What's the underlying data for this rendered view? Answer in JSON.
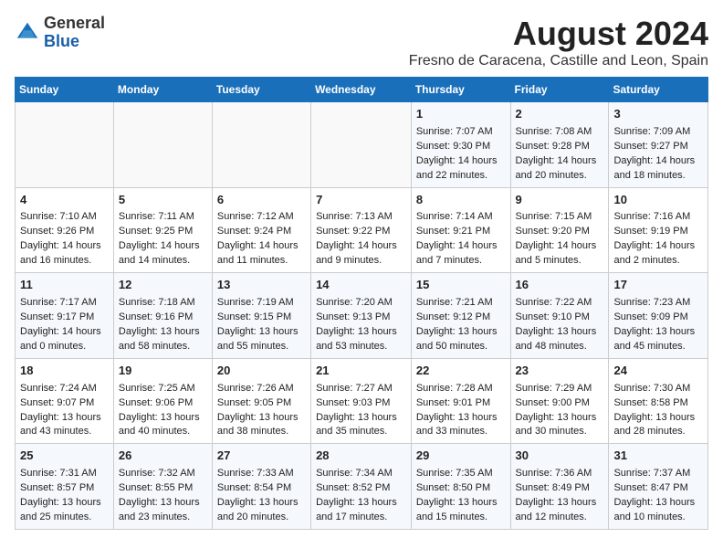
{
  "header": {
    "logo_general": "General",
    "logo_blue": "Blue",
    "month_year": "August 2024",
    "location": "Fresno de Caracena, Castille and Leon, Spain"
  },
  "weekdays": [
    "Sunday",
    "Monday",
    "Tuesday",
    "Wednesday",
    "Thursday",
    "Friday",
    "Saturday"
  ],
  "weeks": [
    [
      {
        "day": "",
        "sunrise": "",
        "sunset": "",
        "daylight": ""
      },
      {
        "day": "",
        "sunrise": "",
        "sunset": "",
        "daylight": ""
      },
      {
        "day": "",
        "sunrise": "",
        "sunset": "",
        "daylight": ""
      },
      {
        "day": "",
        "sunrise": "",
        "sunset": "",
        "daylight": ""
      },
      {
        "day": "1",
        "sunrise": "Sunrise: 7:07 AM",
        "sunset": "Sunset: 9:30 PM",
        "daylight": "Daylight: 14 hours and 22 minutes."
      },
      {
        "day": "2",
        "sunrise": "Sunrise: 7:08 AM",
        "sunset": "Sunset: 9:28 PM",
        "daylight": "Daylight: 14 hours and 20 minutes."
      },
      {
        "day": "3",
        "sunrise": "Sunrise: 7:09 AM",
        "sunset": "Sunset: 9:27 PM",
        "daylight": "Daylight: 14 hours and 18 minutes."
      }
    ],
    [
      {
        "day": "4",
        "sunrise": "Sunrise: 7:10 AM",
        "sunset": "Sunset: 9:26 PM",
        "daylight": "Daylight: 14 hours and 16 minutes."
      },
      {
        "day": "5",
        "sunrise": "Sunrise: 7:11 AM",
        "sunset": "Sunset: 9:25 PM",
        "daylight": "Daylight: 14 hours and 14 minutes."
      },
      {
        "day": "6",
        "sunrise": "Sunrise: 7:12 AM",
        "sunset": "Sunset: 9:24 PM",
        "daylight": "Daylight: 14 hours and 11 minutes."
      },
      {
        "day": "7",
        "sunrise": "Sunrise: 7:13 AM",
        "sunset": "Sunset: 9:22 PM",
        "daylight": "Daylight: 14 hours and 9 minutes."
      },
      {
        "day": "8",
        "sunrise": "Sunrise: 7:14 AM",
        "sunset": "Sunset: 9:21 PM",
        "daylight": "Daylight: 14 hours and 7 minutes."
      },
      {
        "day": "9",
        "sunrise": "Sunrise: 7:15 AM",
        "sunset": "Sunset: 9:20 PM",
        "daylight": "Daylight: 14 hours and 5 minutes."
      },
      {
        "day": "10",
        "sunrise": "Sunrise: 7:16 AM",
        "sunset": "Sunset: 9:19 PM",
        "daylight": "Daylight: 14 hours and 2 minutes."
      }
    ],
    [
      {
        "day": "11",
        "sunrise": "Sunrise: 7:17 AM",
        "sunset": "Sunset: 9:17 PM",
        "daylight": "Daylight: 14 hours and 0 minutes."
      },
      {
        "day": "12",
        "sunrise": "Sunrise: 7:18 AM",
        "sunset": "Sunset: 9:16 PM",
        "daylight": "Daylight: 13 hours and 58 minutes."
      },
      {
        "day": "13",
        "sunrise": "Sunrise: 7:19 AM",
        "sunset": "Sunset: 9:15 PM",
        "daylight": "Daylight: 13 hours and 55 minutes."
      },
      {
        "day": "14",
        "sunrise": "Sunrise: 7:20 AM",
        "sunset": "Sunset: 9:13 PM",
        "daylight": "Daylight: 13 hours and 53 minutes."
      },
      {
        "day": "15",
        "sunrise": "Sunrise: 7:21 AM",
        "sunset": "Sunset: 9:12 PM",
        "daylight": "Daylight: 13 hours and 50 minutes."
      },
      {
        "day": "16",
        "sunrise": "Sunrise: 7:22 AM",
        "sunset": "Sunset: 9:10 PM",
        "daylight": "Daylight: 13 hours and 48 minutes."
      },
      {
        "day": "17",
        "sunrise": "Sunrise: 7:23 AM",
        "sunset": "Sunset: 9:09 PM",
        "daylight": "Daylight: 13 hours and 45 minutes."
      }
    ],
    [
      {
        "day": "18",
        "sunrise": "Sunrise: 7:24 AM",
        "sunset": "Sunset: 9:07 PM",
        "daylight": "Daylight: 13 hours and 43 minutes."
      },
      {
        "day": "19",
        "sunrise": "Sunrise: 7:25 AM",
        "sunset": "Sunset: 9:06 PM",
        "daylight": "Daylight: 13 hours and 40 minutes."
      },
      {
        "day": "20",
        "sunrise": "Sunrise: 7:26 AM",
        "sunset": "Sunset: 9:05 PM",
        "daylight": "Daylight: 13 hours and 38 minutes."
      },
      {
        "day": "21",
        "sunrise": "Sunrise: 7:27 AM",
        "sunset": "Sunset: 9:03 PM",
        "daylight": "Daylight: 13 hours and 35 minutes."
      },
      {
        "day": "22",
        "sunrise": "Sunrise: 7:28 AM",
        "sunset": "Sunset: 9:01 PM",
        "daylight": "Daylight: 13 hours and 33 minutes."
      },
      {
        "day": "23",
        "sunrise": "Sunrise: 7:29 AM",
        "sunset": "Sunset: 9:00 PM",
        "daylight": "Daylight: 13 hours and 30 minutes."
      },
      {
        "day": "24",
        "sunrise": "Sunrise: 7:30 AM",
        "sunset": "Sunset: 8:58 PM",
        "daylight": "Daylight: 13 hours and 28 minutes."
      }
    ],
    [
      {
        "day": "25",
        "sunrise": "Sunrise: 7:31 AM",
        "sunset": "Sunset: 8:57 PM",
        "daylight": "Daylight: 13 hours and 25 minutes."
      },
      {
        "day": "26",
        "sunrise": "Sunrise: 7:32 AM",
        "sunset": "Sunset: 8:55 PM",
        "daylight": "Daylight: 13 hours and 23 minutes."
      },
      {
        "day": "27",
        "sunrise": "Sunrise: 7:33 AM",
        "sunset": "Sunset: 8:54 PM",
        "daylight": "Daylight: 13 hours and 20 minutes."
      },
      {
        "day": "28",
        "sunrise": "Sunrise: 7:34 AM",
        "sunset": "Sunset: 8:52 PM",
        "daylight": "Daylight: 13 hours and 17 minutes."
      },
      {
        "day": "29",
        "sunrise": "Sunrise: 7:35 AM",
        "sunset": "Sunset: 8:50 PM",
        "daylight": "Daylight: 13 hours and 15 minutes."
      },
      {
        "day": "30",
        "sunrise": "Sunrise: 7:36 AM",
        "sunset": "Sunset: 8:49 PM",
        "daylight": "Daylight: 13 hours and 12 minutes."
      },
      {
        "day": "31",
        "sunrise": "Sunrise: 7:37 AM",
        "sunset": "Sunset: 8:47 PM",
        "daylight": "Daylight: 13 hours and 10 minutes."
      }
    ]
  ]
}
